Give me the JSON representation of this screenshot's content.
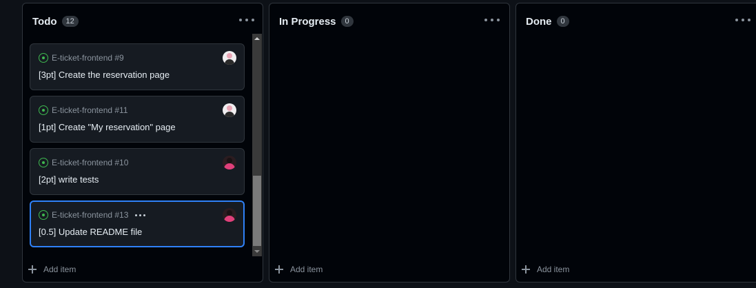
{
  "columns": [
    {
      "title": "Todo",
      "count": "12",
      "add_label": "Add item"
    },
    {
      "title": "In Progress",
      "count": "0",
      "add_label": "Add item"
    },
    {
      "title": "Done",
      "count": "0",
      "add_label": "Add item"
    }
  ],
  "todo_cards": [
    {
      "ref": "E-ticket-frontend #9",
      "title": "[3pt] Create the reservation page",
      "avatar": "avatar-user-1"
    },
    {
      "ref": "E-ticket-frontend #11",
      "title": "[1pt] Create \"My reservation\" page",
      "avatar": "avatar-user-1"
    },
    {
      "ref": "E-ticket-frontend #10",
      "title": "[2pt] write tests",
      "avatar": "avatar-user-2"
    },
    {
      "ref": "E-ticket-frontend #13",
      "title": "[0.5] Update README file",
      "avatar": "avatar-user-2",
      "selected": true
    }
  ],
  "icons": {
    "status": "open-issue-icon",
    "menu": "kebab-menu-icon",
    "add": "plus-icon"
  },
  "colors": {
    "background": "#0d1117",
    "column": "#010409",
    "card": "#161b22",
    "open_issue": "#3fb950",
    "selected_border": "#2f81f7"
  }
}
